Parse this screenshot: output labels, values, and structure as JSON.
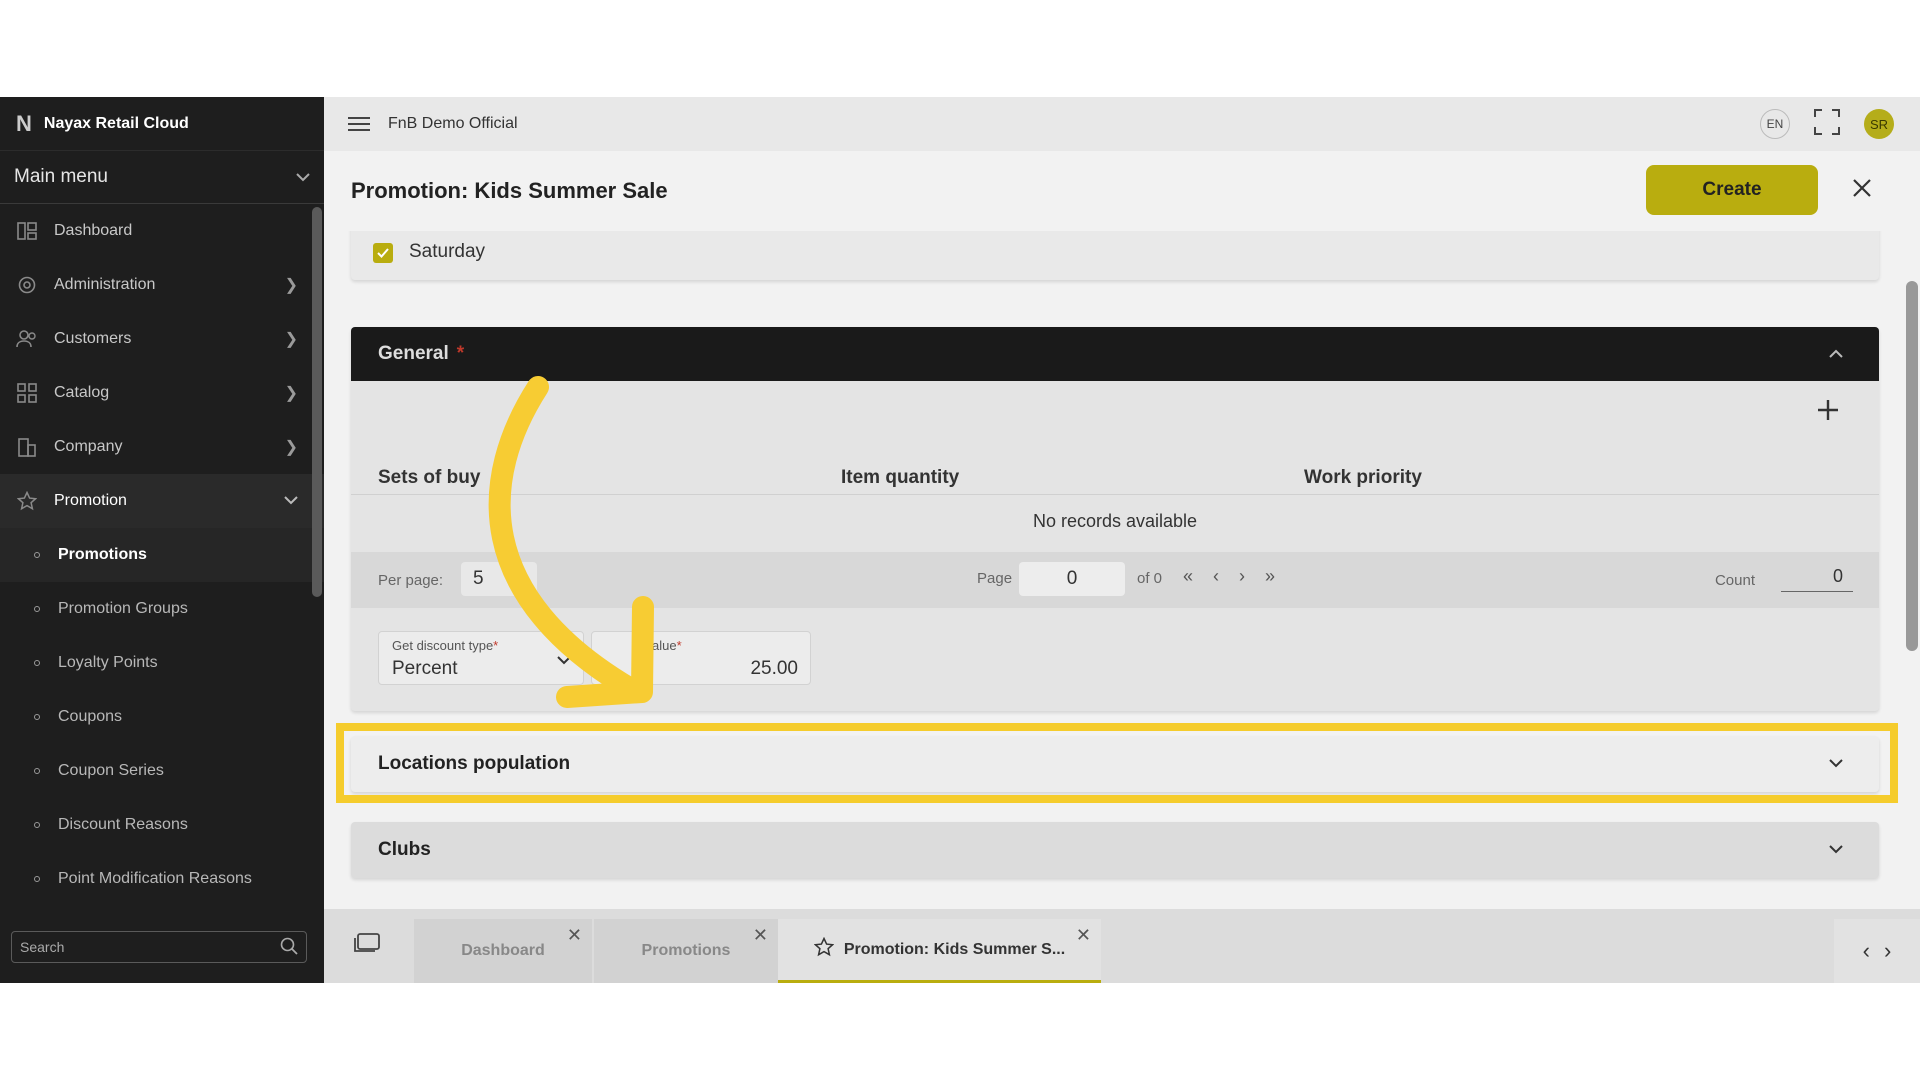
{
  "app": {
    "name": "Nayax Retail Cloud",
    "logo_letter": "N"
  },
  "sidebar": {
    "menu_title": "Main menu",
    "items": [
      {
        "label": "Dashboard",
        "icon": "dashboard-icon"
      },
      {
        "label": "Administration",
        "icon": "admin-gear-icon"
      },
      {
        "label": "Customers",
        "icon": "customers-icon"
      },
      {
        "label": "Catalog",
        "icon": "catalog-grid-icon"
      },
      {
        "label": "Company",
        "icon": "building-icon"
      },
      {
        "label": "Promotion",
        "icon": "star-icon"
      }
    ],
    "sub_items": [
      {
        "label": "Promotions"
      },
      {
        "label": "Promotion Groups"
      },
      {
        "label": "Loyalty Points"
      },
      {
        "label": "Coupons"
      },
      {
        "label": "Coupon Series"
      },
      {
        "label": "Discount Reasons"
      },
      {
        "label": "Point Modification Reasons"
      }
    ],
    "search_placeholder": "Search"
  },
  "topbar": {
    "tenant": "FnB Demo Official",
    "lang": "EN",
    "avatar": "SR"
  },
  "page": {
    "title": "Promotion: Kids Summer Sale",
    "create_label": "Create"
  },
  "days": {
    "saturday_label": "Saturday",
    "saturday_checked": true
  },
  "general": {
    "title": "General",
    "columns": [
      "Sets of buy",
      "Item quantity",
      "Work priority"
    ],
    "empty_text": "No records available",
    "pager": {
      "per_page_label": "Per page:",
      "per_page_value": "5",
      "page_label": "Page",
      "page_value": "0",
      "of_label": "of 0",
      "count_label": "Count",
      "count_value": "0"
    },
    "discount_type": {
      "label": "Get discount type",
      "value": "Percent"
    },
    "discount_value": {
      "label": "alue",
      "value": "25.00"
    }
  },
  "sections": {
    "locations": "Locations population",
    "clubs": "Clubs"
  },
  "tabs": [
    {
      "label": "Dashboard"
    },
    {
      "label": "Promotions"
    },
    {
      "label": "Promotion: Kids Summer S..."
    }
  ],
  "colors": {
    "accent": "#b9ad0f",
    "highlight": "#f5cc2c",
    "sidebar": "#1e1e1e"
  }
}
